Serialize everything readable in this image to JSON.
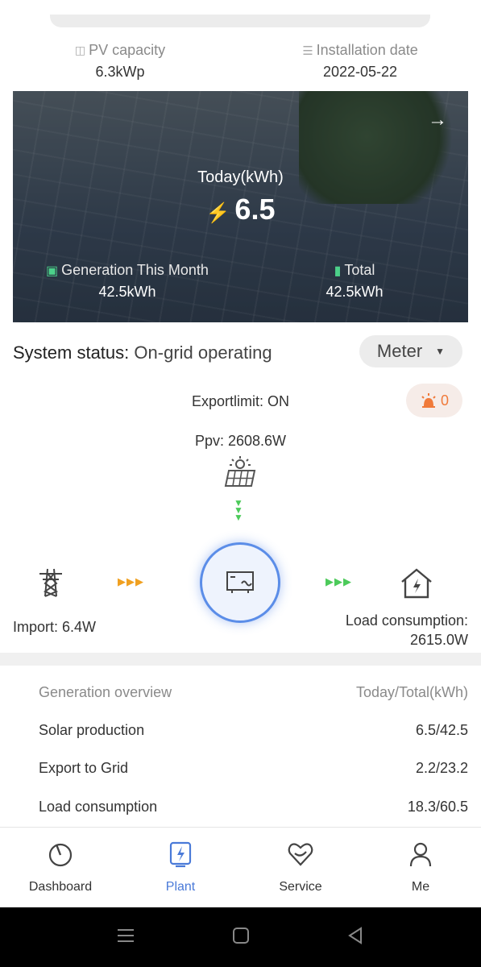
{
  "specs": {
    "pv_capacity_label": "PV capacity",
    "pv_capacity_value": "6.3kWp",
    "install_date_label": "Installation date",
    "install_date_value": "2022-05-22"
  },
  "hero": {
    "today_label": "Today(kWh)",
    "today_value": "6.5",
    "month_label": "Generation This Month",
    "month_value": "42.5kWh",
    "total_label": "Total",
    "total_value": "42.5kWh"
  },
  "status": {
    "label": "System status:",
    "value": "On-grid operating",
    "meter_select": "Meter"
  },
  "flow": {
    "export_limit": "Exportlimit: ON",
    "alarm_count": "0",
    "ppv": "Ppv: 2608.6W",
    "import": "Import: 6.4W",
    "load_line1": "Load consumption:",
    "load_line2": "2615.0W"
  },
  "overview": {
    "header_left": "Generation overview",
    "header_right": "Today/Total(kWh)",
    "rows": [
      {
        "label": "Solar production",
        "value": "6.5/42.5"
      },
      {
        "label": "Export to Grid",
        "value": "2.2/23.2"
      },
      {
        "label": "Load consumption",
        "value": "18.3/60.5"
      }
    ]
  },
  "tabs": [
    {
      "label": "Dashboard",
      "icon": "dashboard-icon"
    },
    {
      "label": "Plant",
      "icon": "plant-icon",
      "active": true
    },
    {
      "label": "Service",
      "icon": "service-icon"
    },
    {
      "label": "Me",
      "icon": "user-icon"
    }
  ],
  "colors": {
    "accent": "#4a7ad8",
    "green": "#4cca5a",
    "orange": "#f0a020",
    "alarm": "#f07a3a"
  }
}
